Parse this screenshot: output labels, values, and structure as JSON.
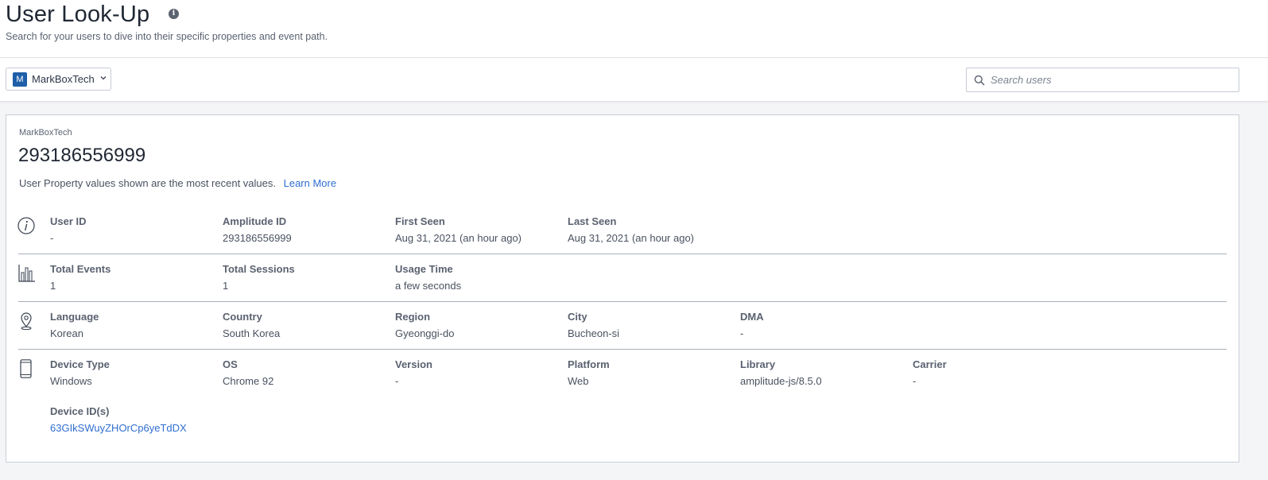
{
  "header": {
    "title": "User Look-Up",
    "info_glyph": "i",
    "subtitle": "Search for your users to dive into their specific properties and event path."
  },
  "toolbar": {
    "project_initial": "M",
    "project_name": "MarkBoxTech",
    "search_placeholder": "Search users",
    "search_value": ""
  },
  "card": {
    "project": "MarkBoxTech",
    "user": "293186556999",
    "note": "User Property values shown are the most recent values.",
    "learn_more": "Learn More"
  },
  "identity": {
    "icon": "info-circle-icon",
    "fields": [
      {
        "label": "User ID",
        "value": "-"
      },
      {
        "label": "Amplitude ID",
        "value": "293186556999"
      },
      {
        "label": "First Seen",
        "value": "Aug 31, 2021 (an hour ago)"
      },
      {
        "label": "Last Seen",
        "value": "Aug 31, 2021 (an hour ago)"
      }
    ]
  },
  "activity": {
    "icon": "bar-chart-icon",
    "fields": [
      {
        "label": "Total Events",
        "value": "1"
      },
      {
        "label": "Total Sessions",
        "value": "1"
      },
      {
        "label": "Usage Time",
        "value": "a few seconds"
      }
    ]
  },
  "location": {
    "icon": "map-pin-icon",
    "fields": [
      {
        "label": "Language",
        "value": "Korean"
      },
      {
        "label": "Country",
        "value": "South Korea"
      },
      {
        "label": "Region",
        "value": "Gyeonggi-do"
      },
      {
        "label": "City",
        "value": "Bucheon-si"
      },
      {
        "label": "DMA",
        "value": "-"
      }
    ]
  },
  "device": {
    "icon": "mobile-device-icon",
    "fields": [
      {
        "label": "Device Type",
        "value": "Windows"
      },
      {
        "label": "OS",
        "value": "Chrome 92"
      },
      {
        "label": "Version",
        "value": "-"
      },
      {
        "label": "Platform",
        "value": "Web"
      },
      {
        "label": "Library",
        "value": "amplitude-js/8.5.0"
      },
      {
        "label": "Carrier",
        "value": "-"
      }
    ],
    "device_ids_label": "Device ID(s)",
    "device_ids_value": "63GIkSWuyZHOrCp6yeTdDX"
  }
}
